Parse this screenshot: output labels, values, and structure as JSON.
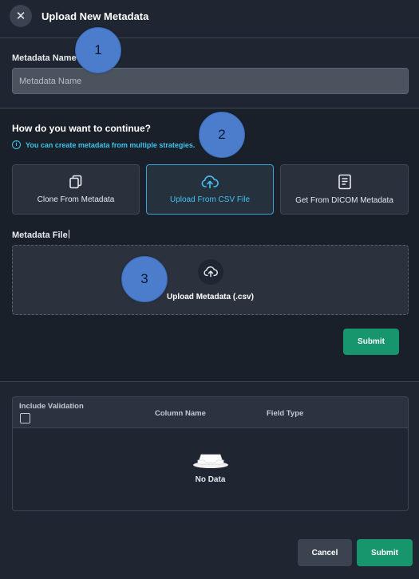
{
  "header": {
    "title": "Upload New Metadata",
    "close_glyph": "✕"
  },
  "metadata_name": {
    "label": "Metadata Name",
    "placeholder": "Metadata Name",
    "value": ""
  },
  "strategy": {
    "question": "How do you want to continue?",
    "hint": "You can create metadata from multiple strategies.",
    "options": [
      {
        "label": "Clone From Metadata",
        "icon": "copy-icon",
        "selected": false
      },
      {
        "label": "Upload From CSV File",
        "icon": "cloud-upload-icon",
        "selected": true
      },
      {
        "label": "Get From DICOM Metadata",
        "icon": "document-icon",
        "selected": false
      }
    ]
  },
  "metadata_file": {
    "label": "Metadata File",
    "dropzone_label": "Upload Metadata (.csv)",
    "dropzone_icon": "cloud-upload-icon"
  },
  "upload_submit_label": "Submit",
  "table": {
    "columns": [
      "Include Validation",
      "Column Name",
      "Field Type"
    ],
    "empty_text": "No Data",
    "empty_icon": "empty-inbox-icon"
  },
  "footer": {
    "cancel_label": "Cancel",
    "submit_label": "Submit"
  },
  "markers": [
    "1",
    "2",
    "3"
  ],
  "colors": {
    "accent": "#3ec3ea",
    "selected_border": "#3aa3d9",
    "primary_button": "#17956c",
    "background": "#1f2631",
    "marker": "#4c7dcc"
  }
}
